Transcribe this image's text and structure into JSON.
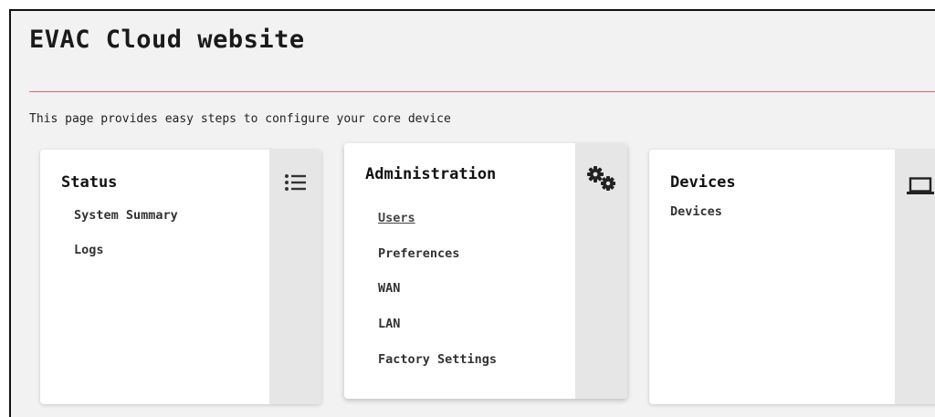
{
  "page": {
    "title": "EVAC Cloud website",
    "intro": "This page provides easy steps to configure your core device"
  },
  "cards": {
    "status": {
      "title": "Status",
      "icon": "list-icon",
      "links": [
        "System Summary",
        "Logs"
      ]
    },
    "administration": {
      "title": "Administration",
      "icon": "gears-icon",
      "links": [
        "Users",
        "Preferences",
        "WAN",
        "LAN",
        "Factory Settings"
      ]
    },
    "devices": {
      "title": "Devices",
      "icon": "laptop-icon",
      "links": [
        "Devices"
      ]
    }
  },
  "colors": {
    "divider": "#e06666",
    "background": "#f2f2f2",
    "card_side": "#e6e6e6"
  }
}
